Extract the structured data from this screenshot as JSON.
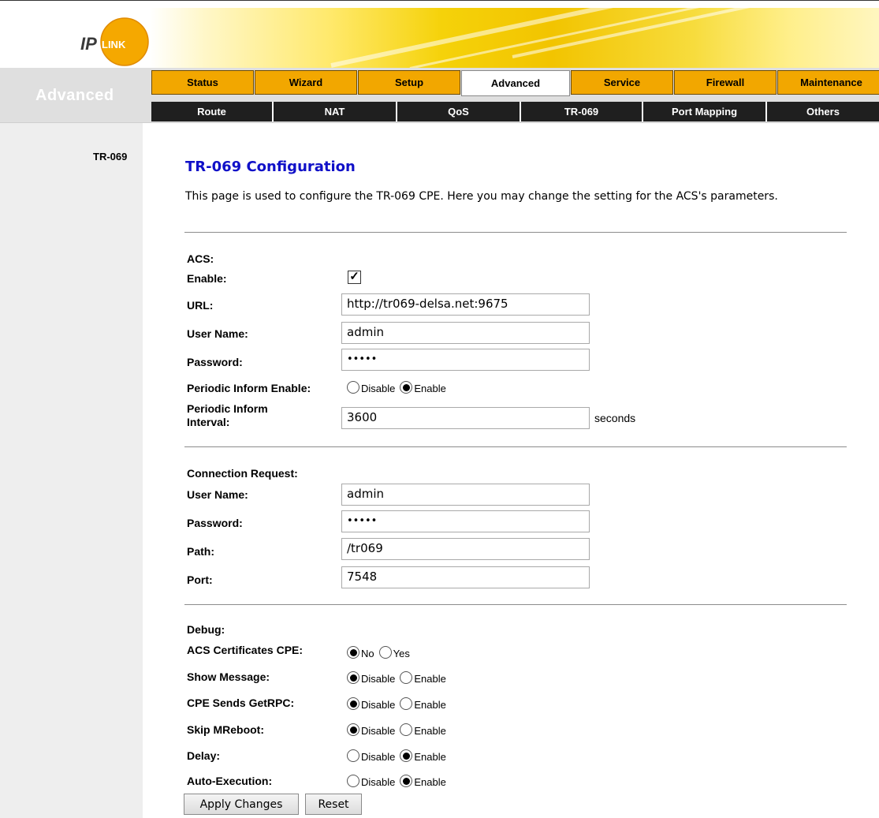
{
  "brand": {
    "logo_text_ip": "IP",
    "logo_text_link": "LINK"
  },
  "section_title": "Advanced",
  "main_tabs": [
    {
      "label": "Status"
    },
    {
      "label": "Wizard"
    },
    {
      "label": "Setup"
    },
    {
      "label": "Advanced",
      "active": true
    },
    {
      "label": "Service"
    },
    {
      "label": "Firewall"
    },
    {
      "label": "Maintenance"
    }
  ],
  "sub_tabs": [
    {
      "label": "Route"
    },
    {
      "label": "NAT"
    },
    {
      "label": "QoS"
    },
    {
      "label": "TR-069",
      "active": true
    },
    {
      "label": "Port Mapping"
    },
    {
      "label": "Others"
    }
  ],
  "sidebar": {
    "items": [
      {
        "label": "TR-069"
      }
    ]
  },
  "page": {
    "title": "TR-069 Configuration",
    "description": "This page is used to configure the TR-069 CPE. Here you may change the setting for the ACS's parameters."
  },
  "acs": {
    "heading": "ACS:",
    "enable_label": "Enable:",
    "enable_checked": true,
    "url_label": "URL:",
    "url_value": "http://tr069-delsa.net:9675",
    "username_label": "User Name:",
    "username_value": "admin",
    "password_label": "Password:",
    "password_value": "•••••",
    "periodic_enable_label": "Periodic Inform Enable:",
    "periodic_enable_options": [
      "Disable",
      "Enable"
    ],
    "periodic_enable_selected": "Enable",
    "periodic_interval_label_line1": "Periodic Inform",
    "periodic_interval_label_line2": "Interval:",
    "periodic_interval_value": "3600",
    "periodic_interval_unit": "seconds"
  },
  "connection_request": {
    "heading": "Connection Request:",
    "username_label": "User Name:",
    "username_value": "admin",
    "password_label": "Password:",
    "password_value": "•••••",
    "path_label": "Path:",
    "path_value": "/tr069",
    "port_label": "Port:",
    "port_value": "7548"
  },
  "debug": {
    "heading": "Debug:",
    "rows": [
      {
        "label": "ACS Certificates CPE:",
        "options": [
          "No",
          "Yes"
        ],
        "selected": 0
      },
      {
        "label": "Show Message:",
        "options": [
          "Disable",
          "Enable"
        ],
        "selected": 0
      },
      {
        "label": "CPE Sends GetRPC:",
        "options": [
          "Disable",
          "Enable"
        ],
        "selected": 0
      },
      {
        "label": "Skip MReboot:",
        "options": [
          "Disable",
          "Enable"
        ],
        "selected": 0
      },
      {
        "label": "Delay:",
        "options": [
          "Disable",
          "Enable"
        ],
        "selected": 1
      },
      {
        "label": "Auto-Execution:",
        "options": [
          "Disable",
          "Enable"
        ],
        "selected": 1
      }
    ]
  },
  "buttons": {
    "apply": "Apply Changes",
    "reset": "Reset"
  },
  "colors": {
    "tab_orange": "#f2a700",
    "subtab_dark": "#1f1f1f",
    "title_blue": "#1010c8",
    "banner_yellow": "#f2c400"
  }
}
